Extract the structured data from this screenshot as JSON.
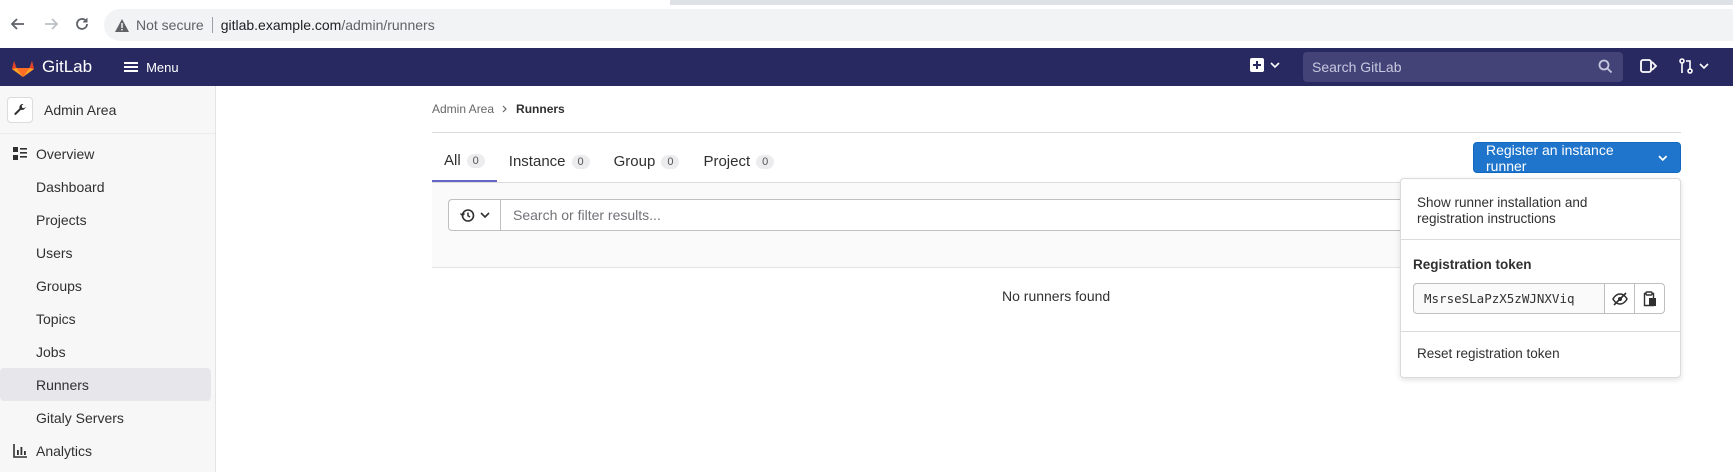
{
  "browser": {
    "not_secure": "Not secure",
    "url_host": "gitlab.example.com",
    "url_path": "/admin/runners"
  },
  "header": {
    "brand": "GitLab",
    "menu_label": "Menu",
    "search_placeholder": "Search GitLab"
  },
  "sidebar": {
    "title": "Admin Area",
    "items": [
      {
        "label": "Overview",
        "icon": "overview-icon",
        "type": "section"
      },
      {
        "label": "Dashboard",
        "type": "sub"
      },
      {
        "label": "Projects",
        "type": "sub"
      },
      {
        "label": "Users",
        "type": "sub"
      },
      {
        "label": "Groups",
        "type": "sub"
      },
      {
        "label": "Topics",
        "type": "sub"
      },
      {
        "label": "Jobs",
        "type": "sub"
      },
      {
        "label": "Runners",
        "type": "sub",
        "active": true
      },
      {
        "label": "Gitaly Servers",
        "type": "sub"
      },
      {
        "label": "Analytics",
        "icon": "analytics-icon",
        "type": "section"
      }
    ]
  },
  "breadcrumb": {
    "parent": "Admin Area",
    "current": "Runners"
  },
  "tabs": [
    {
      "label": "All",
      "count": "0",
      "active": true
    },
    {
      "label": "Instance",
      "count": "0"
    },
    {
      "label": "Group",
      "count": "0"
    },
    {
      "label": "Project",
      "count": "0"
    }
  ],
  "filter": {
    "placeholder": "Search or filter results..."
  },
  "empty_state": "No runners found",
  "register_button": "Register an instance runner",
  "dropdown": {
    "instructions": "Show runner installation and registration instructions",
    "token_label": "Registration token",
    "token_value": "MsrseSLaPzX5zWJNXViq",
    "reset": "Reset registration token"
  },
  "colors": {
    "header_bg": "#292961",
    "primary_button": "#1f75cb",
    "active_tab_underline": "#6666c4"
  }
}
